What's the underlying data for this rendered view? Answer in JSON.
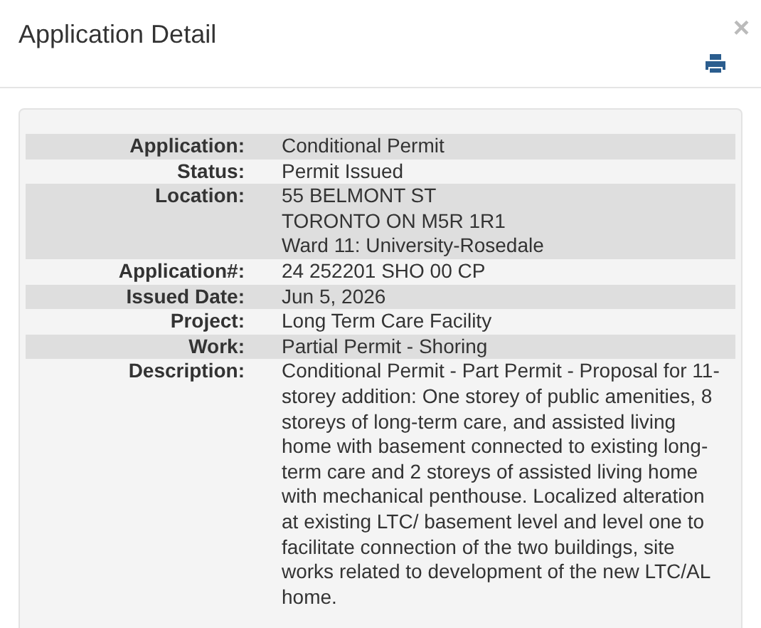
{
  "modal": {
    "title": "Application Detail",
    "close": "×"
  },
  "details": [
    {
      "label": "Application:",
      "lines": [
        "Conditional Permit"
      ]
    },
    {
      "label": "Status:",
      "lines": [
        "Permit Issued"
      ]
    },
    {
      "label": "Location:",
      "lines": [
        "55 BELMONT ST",
        "TORONTO ON M5R 1R1",
        "Ward 11: University-Rosedale"
      ]
    },
    {
      "label": "Application#:",
      "lines": [
        "24 252201 SHO 00 CP"
      ]
    },
    {
      "label": "Issued Date:",
      "lines": [
        "Jun 5, 2026"
      ]
    },
    {
      "label": "Project:",
      "lines": [
        "Long Term Care Facility"
      ]
    },
    {
      "label": "Work:",
      "lines": [
        "Partial Permit - Shoring"
      ]
    },
    {
      "label": "Description:",
      "lines": [
        "Conditional Permit - Part Permit - Proposal for 11-storey addition: One storey of public amenities, 8 storeys of long-term care, and assisted living home with basement connected to existing long-term care and 2 storeys of assisted living home with mechanical penthouse. Localized alteration at existing LTC/ basement level and level one to facilitate connection of the two buildings, site works related to development of the new LTC/AL home."
      ]
    }
  ]
}
